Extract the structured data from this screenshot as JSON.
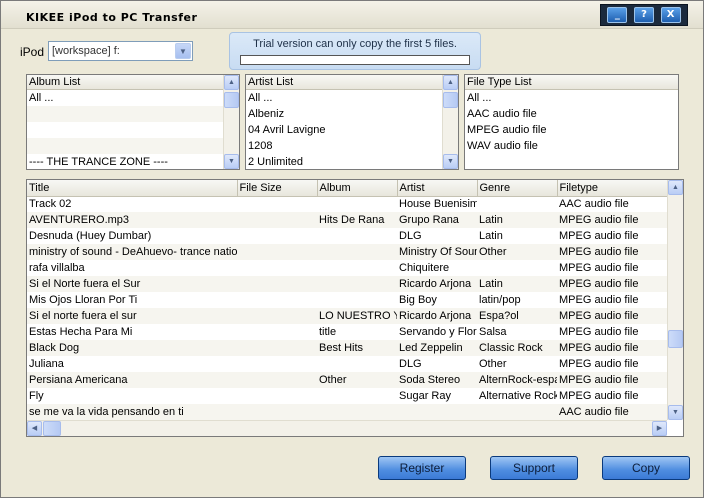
{
  "window": {
    "title": "KIKEE iPod to PC Transfer",
    "controls": {
      "minimize": "_",
      "help": "?",
      "close": "X"
    }
  },
  "ipod": {
    "label": "iPod",
    "selected": "[workspace]  f:"
  },
  "trial": {
    "message": "Trial version can only copy the first 5 files.",
    "progress": 0
  },
  "album_list": {
    "header": "Album List",
    "items": [
      "All ...",
      "",
      "",
      "",
      "---- THE TRANCE ZONE ----"
    ]
  },
  "artist_list": {
    "header": "Artist List",
    "items": [
      "All ...",
      " Albeniz",
      "04 Avril Lavigne",
      "1208",
      "2 Unlimited"
    ]
  },
  "filetype_list": {
    "header": "File Type List",
    "items": [
      "All ...",
      "AAC audio file",
      "MPEG audio file",
      "WAV audio file"
    ]
  },
  "tracks": {
    "columns": [
      "Title",
      "File Size",
      "Album",
      "Artist",
      "Genre",
      "Filetype"
    ],
    "rows": [
      [
        "Track 02",
        "",
        "",
        "House Buenisimo",
        "",
        "AAC audio file"
      ],
      [
        "AVENTURERO.mp3",
        "",
        "Hits De Rana",
        "Grupo Rana",
        "Latin",
        "MPEG audio file"
      ],
      [
        "Desnuda (Huey Dumbar)",
        "",
        "",
        "DLG",
        "Latin",
        "MPEG audio file"
      ],
      [
        "ministry of sound - DeAhuevo- trance nation",
        "",
        "",
        "Ministry Of Sound",
        "Other",
        "MPEG audio file"
      ],
      [
        "rafa villalba",
        "",
        "",
        "Chiquitere",
        "",
        "MPEG audio file"
      ],
      [
        "Si el Norte fuera el Sur",
        "",
        "",
        "Ricardo Arjona",
        "Latin",
        "MPEG audio file"
      ],
      [
        "Mis Ojos Lloran Por Ti",
        "",
        "",
        "Big Boy",
        "latin/pop",
        "MPEG audio file"
      ],
      [
        "Si el norte fuera el sur",
        "",
        "LO NUESTRO Y LO",
        "Ricardo Arjona",
        "Espa?ol",
        "MPEG audio file"
      ],
      [
        "Estas Hecha Para Mi",
        "",
        "title",
        "Servando y Florentino",
        "Salsa",
        "MPEG audio file"
      ],
      [
        "Black Dog",
        "",
        "Best Hits",
        "Led Zeppelin",
        "Classic Rock",
        "MPEG audio file"
      ],
      [
        "Juliana",
        "",
        "",
        "DLG",
        "Other",
        "MPEG audio file"
      ],
      [
        "Persiana Americana",
        "",
        "Other",
        "Soda Stereo",
        "AlternRock-espanol",
        "MPEG audio file"
      ],
      [
        "Fly",
        "",
        "",
        "Sugar Ray",
        "Alternative Rock",
        "MPEG audio file"
      ],
      [
        "se me va la vida pensando en ti",
        "",
        "",
        "",
        "",
        "AAC audio file"
      ]
    ]
  },
  "buttons": {
    "register": "Register",
    "support": "Support",
    "copy": "Copy"
  }
}
